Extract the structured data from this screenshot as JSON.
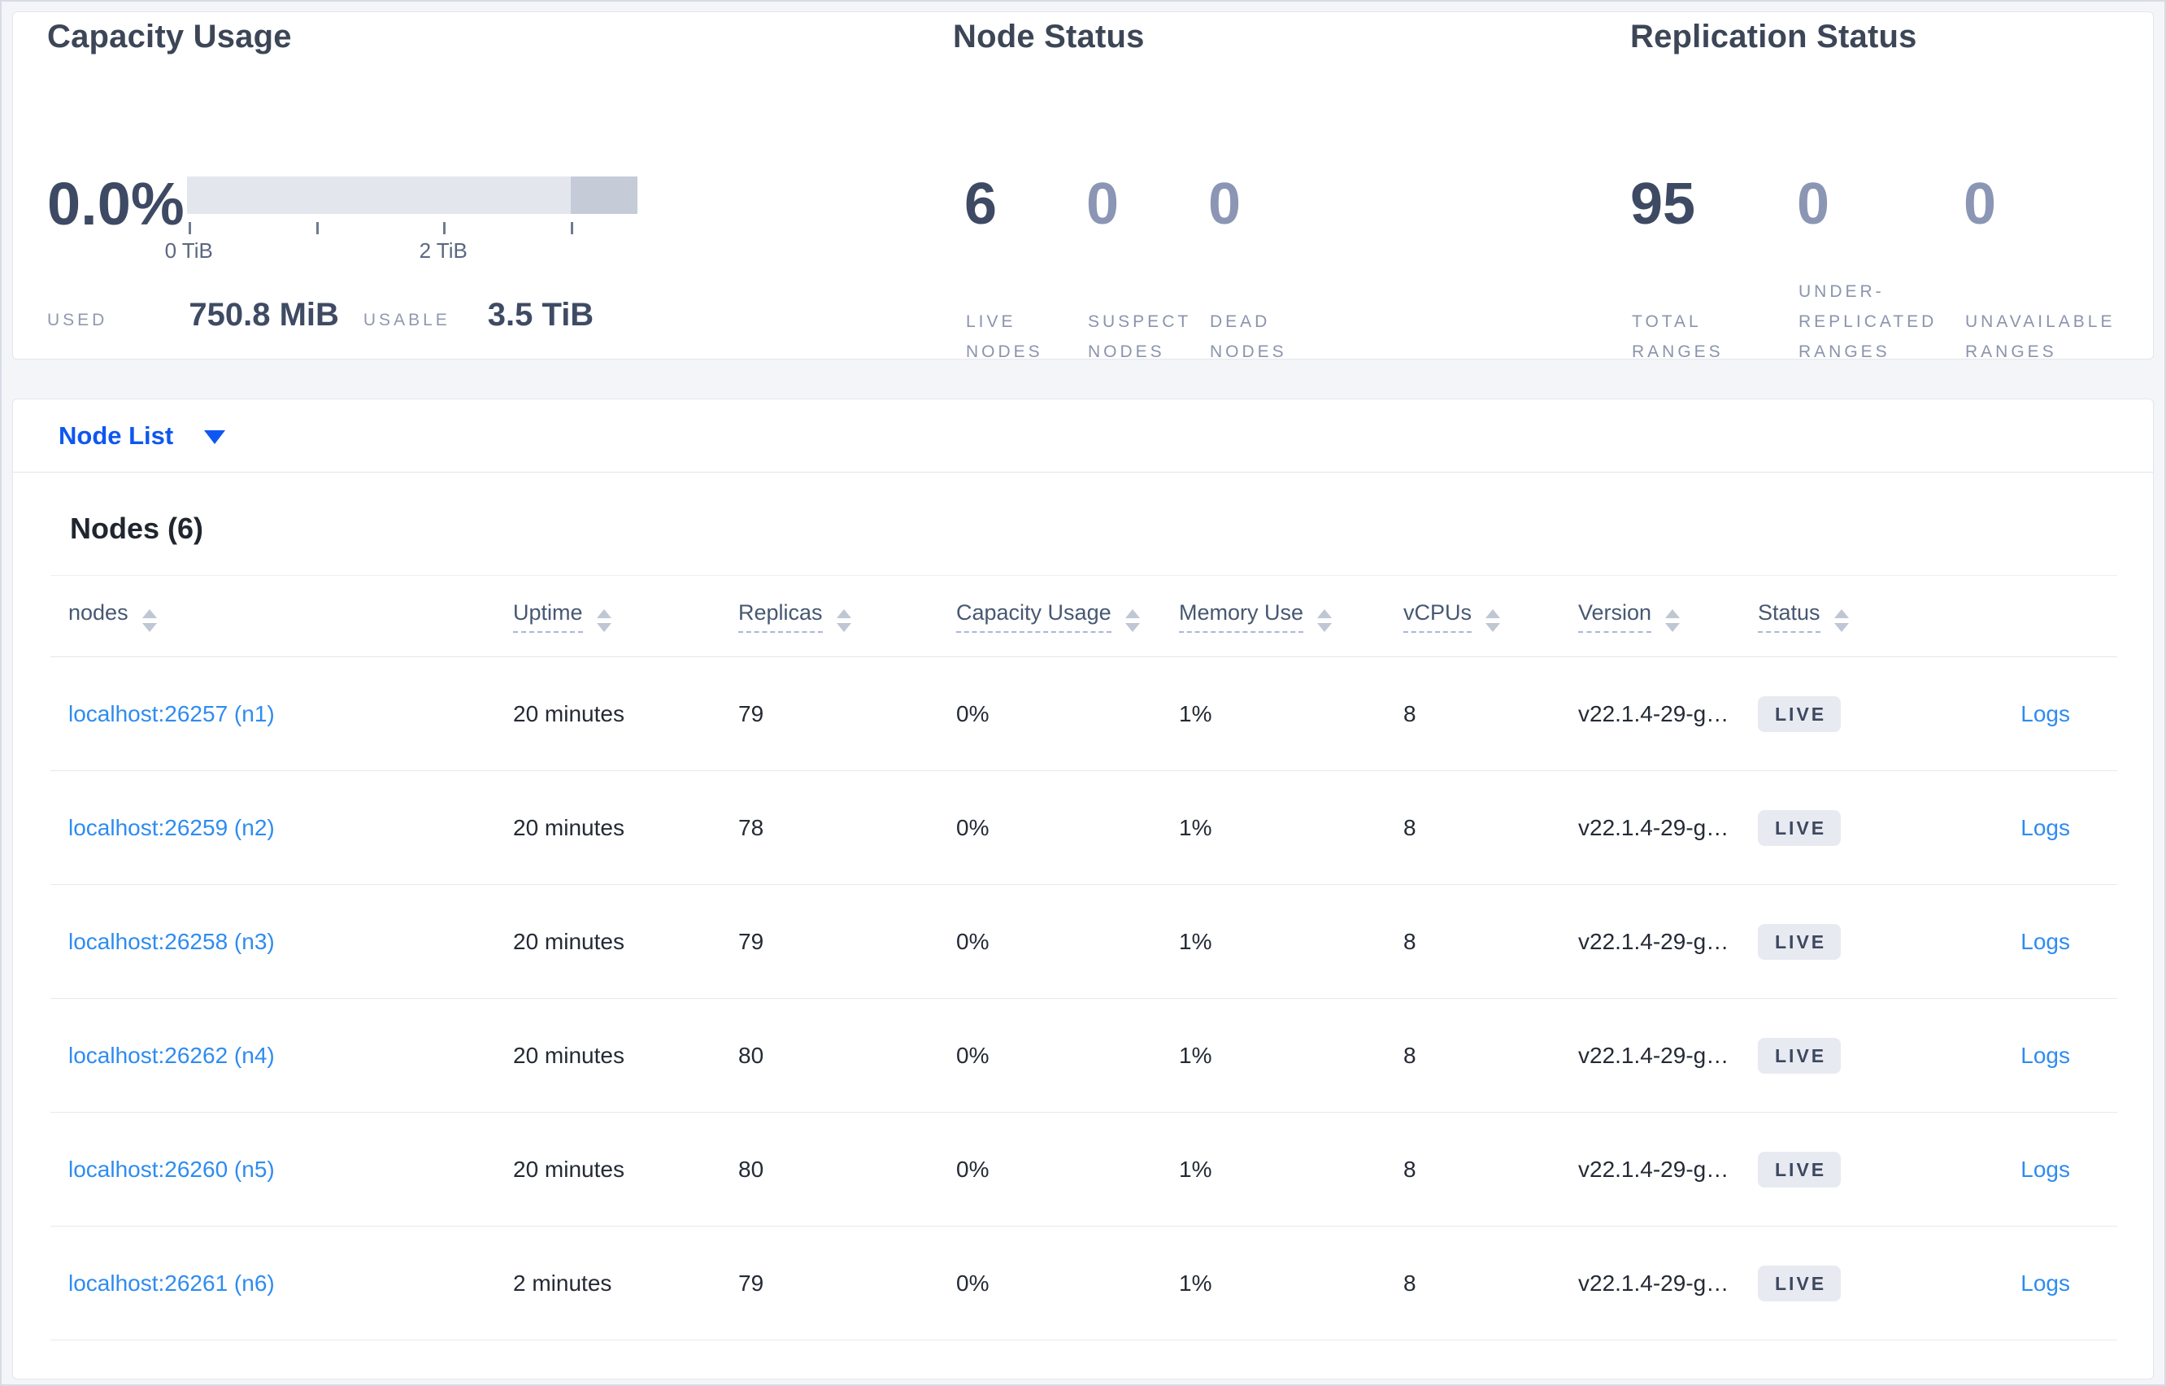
{
  "colors": {
    "page_bg": "#f4f5f9",
    "nav_blue": "#0e57f1",
    "link_blue": "#2e8cf0",
    "stat_dark": "#3e4a63",
    "stat_muted": "#8b96b5",
    "bar_light": "#e4e6ee",
    "bar_dark": "#c6cbd8",
    "badge_bg": "#e7eaf0"
  },
  "summary": {
    "capacity": {
      "title": "Capacity Usage",
      "percent": "0.0%",
      "used_label": "USED",
      "used_value": "750.8 MiB",
      "usable_label": "USABLE",
      "usable_value": "3.5 TiB",
      "bar": {
        "dark_start_pct": 85.2,
        "ticks": [
          {
            "pos_pct": 0.4,
            "label": "0 TiB"
          },
          {
            "pos_pct": 28.7,
            "label": ""
          },
          {
            "pos_pct": 56.9,
            "label": "2 TiB"
          },
          {
            "pos_pct": 85.2,
            "label": ""
          }
        ]
      }
    },
    "node_status": {
      "title": "Node Status",
      "stats": [
        {
          "value": "6",
          "lines": [
            "LIVE",
            "NODES"
          ],
          "muted": false
        },
        {
          "value": "0",
          "lines": [
            "SUSPECT",
            "NODES"
          ],
          "muted": true
        },
        {
          "value": "0",
          "lines": [
            "DEAD",
            "NODES"
          ],
          "muted": true
        }
      ]
    },
    "replication": {
      "title": "Replication Status",
      "stats": [
        {
          "value": "95",
          "lines": [
            "TOTAL",
            "RANGES"
          ],
          "muted": false
        },
        {
          "value": "0",
          "lines": [
            "UNDER-",
            "REPLICATED",
            "RANGES"
          ],
          "muted": true
        },
        {
          "value": "0",
          "lines": [
            "UNAVAILABLE",
            "RANGES"
          ],
          "muted": true
        }
      ]
    }
  },
  "node_list": {
    "label": "Node List"
  },
  "nodes_table": {
    "title": "Nodes (6)",
    "logs_label": "Logs",
    "columns": [
      {
        "label": "nodes",
        "underline": false
      },
      {
        "label": "Uptime",
        "underline": true
      },
      {
        "label": "Replicas",
        "underline": true
      },
      {
        "label": "Capacity Usage",
        "underline": true
      },
      {
        "label": "Memory Use",
        "underline": true
      },
      {
        "label": "vCPUs",
        "underline": true
      },
      {
        "label": "Version",
        "underline": true
      },
      {
        "label": "Status",
        "underline": true
      },
      {
        "label": "",
        "underline": false
      }
    ],
    "rows": [
      {
        "node": "localhost:26257 (n1)",
        "uptime": "20 minutes",
        "replicas": "79",
        "capacity_usage": "0%",
        "memory_use": "1%",
        "vcpus": "8",
        "version": "v22.1.4-29-g…",
        "status": "LIVE"
      },
      {
        "node": "localhost:26259 (n2)",
        "uptime": "20 minutes",
        "replicas": "78",
        "capacity_usage": "0%",
        "memory_use": "1%",
        "vcpus": "8",
        "version": "v22.1.4-29-g…",
        "status": "LIVE"
      },
      {
        "node": "localhost:26258 (n3)",
        "uptime": "20 minutes",
        "replicas": "79",
        "capacity_usage": "0%",
        "memory_use": "1%",
        "vcpus": "8",
        "version": "v22.1.4-29-g…",
        "status": "LIVE"
      },
      {
        "node": "localhost:26262 (n4)",
        "uptime": "20 minutes",
        "replicas": "80",
        "capacity_usage": "0%",
        "memory_use": "1%",
        "vcpus": "8",
        "version": "v22.1.4-29-g…",
        "status": "LIVE"
      },
      {
        "node": "localhost:26260 (n5)",
        "uptime": "20 minutes",
        "replicas": "80",
        "capacity_usage": "0%",
        "memory_use": "1%",
        "vcpus": "8",
        "version": "v22.1.4-29-g…",
        "status": "LIVE"
      },
      {
        "node": "localhost:26261 (n6)",
        "uptime": "2 minutes",
        "replicas": "79",
        "capacity_usage": "0%",
        "memory_use": "1%",
        "vcpus": "8",
        "version": "v22.1.4-29-g…",
        "status": "LIVE"
      }
    ]
  }
}
